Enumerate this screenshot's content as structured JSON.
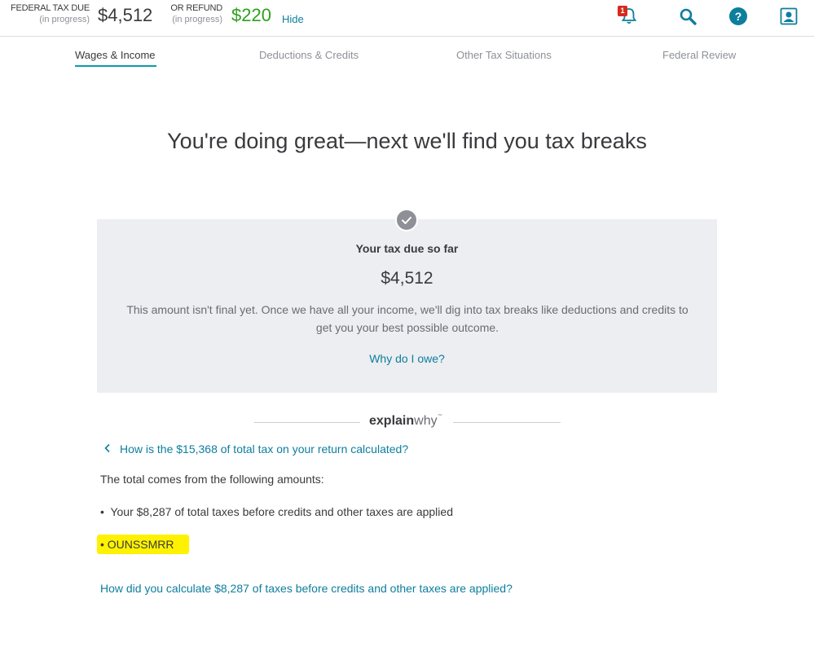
{
  "header": {
    "federal_label": "FEDERAL TAX DUE",
    "federal_sub": "(in progress)",
    "federal_amount": "$4,512",
    "refund_label": "OR REFUND",
    "refund_sub": "(in progress)",
    "refund_amount": "$220",
    "hide_label": "Hide",
    "notification_count": "1",
    "icons": [
      "bell-icon",
      "search-icon",
      "help-icon",
      "profile-icon"
    ],
    "colors": {
      "refund": "#2ca01c",
      "link": "#0d7e9e",
      "badge": "#d52b1e",
      "highlight": "#fff200"
    }
  },
  "tabs": [
    {
      "label": "Wages & Income",
      "active": true
    },
    {
      "label": "Deductions & Credits",
      "active": false
    },
    {
      "label": "Other Tax Situations",
      "active": false
    },
    {
      "label": "Federal Review",
      "active": false
    }
  ],
  "main": {
    "heading": "You're doing great—next we'll find you tax breaks",
    "card": {
      "title": "Your tax due so far",
      "amount": "$4,512",
      "text": "This amount isn't final yet. Once we have all your income, we'll dig into tax breaks like deductions and credits to get you your best possible outcome.",
      "link": "Why do I owe?"
    },
    "explainwhy": {
      "bold": "explain",
      "light": "why",
      "tm": "™",
      "question": "How is the $15,368 of total tax on your return calculated?",
      "intro": "The total comes from the following amounts:",
      "bullets": [
        "Your $8,287 of total taxes before credits and other taxes are applied",
        "OUNSSMRR"
      ],
      "bullet_glyph": "•",
      "bottom_link": "How did you calculate $8,287 of taxes before credits and other taxes are applied?"
    }
  }
}
